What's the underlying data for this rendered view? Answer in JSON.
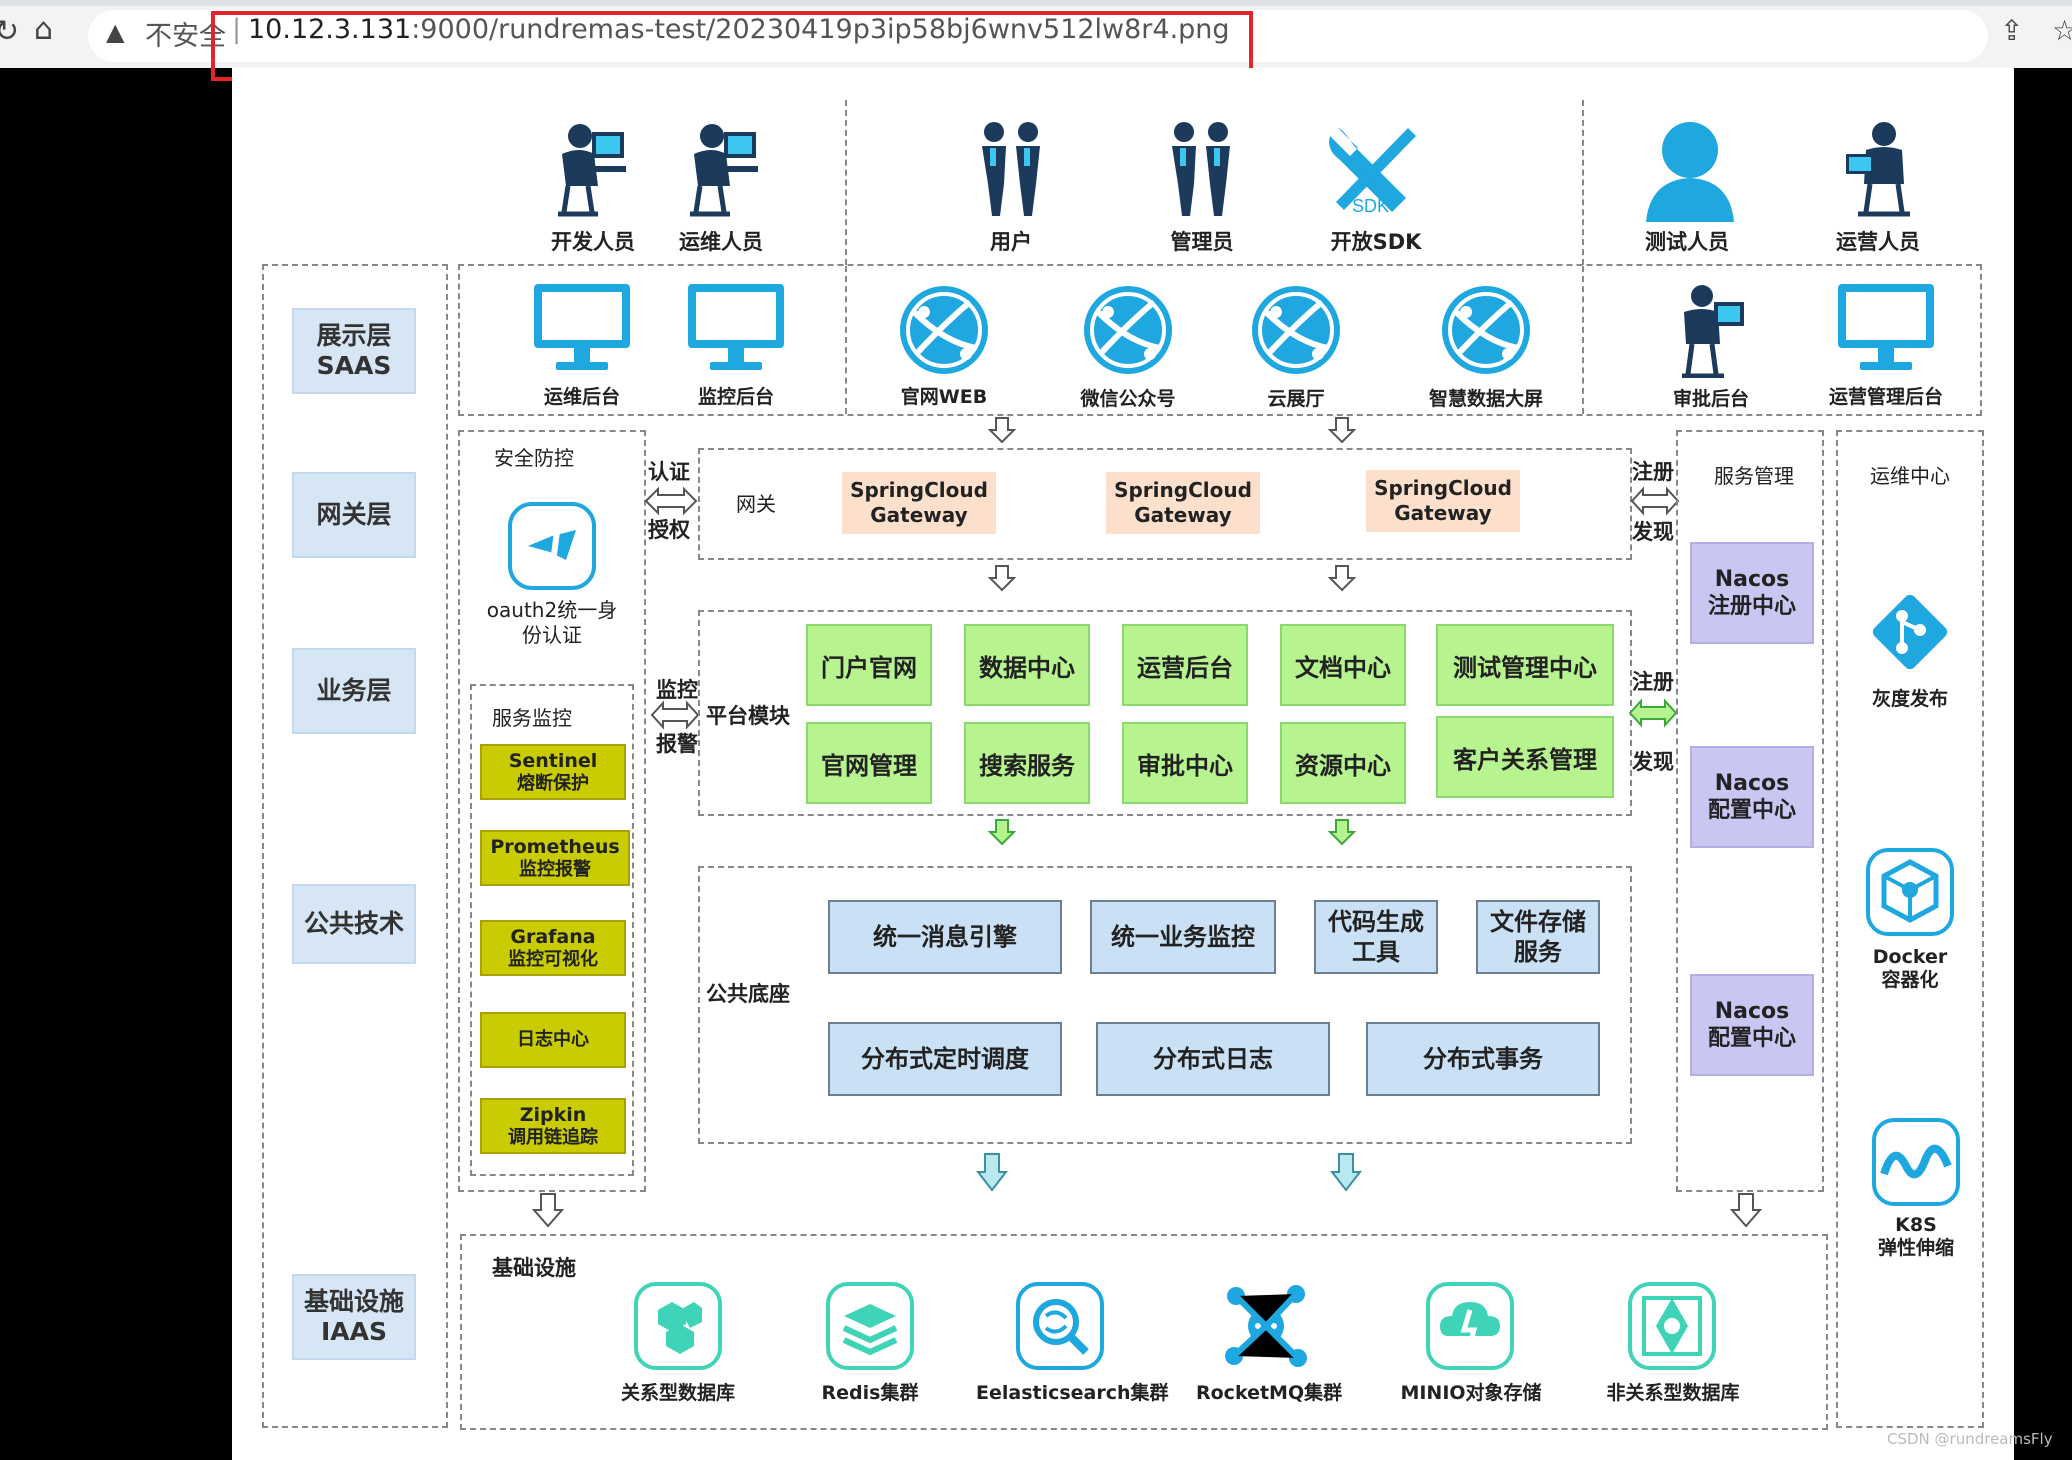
{
  "browser": {
    "insecure_label": "不安全",
    "url_host": "10.12.3.131",
    "url_path": ":9000/rundremas-test/20230419p3ip58bj6wnv512lw8r4.png"
  },
  "roles": [
    "开发人员",
    "运维人员",
    "用户",
    "管理员",
    "开放SDK",
    "测试人员",
    "运营人员"
  ],
  "layers": [
    "展示层\nSAAS",
    "网关层",
    "业务层",
    "公共技术",
    "基础设施\nIAAS"
  ],
  "saas": {
    "items": [
      "运维后台",
      "监控后台",
      "官网WEB",
      "微信公众号",
      "云展厅",
      "智慧数据大屏",
      "审批后台",
      "运营管理后台"
    ]
  },
  "security": {
    "title": "安全防控",
    "oauth": "oauth2统一身\n份认证",
    "auth_left": "认证",
    "auth_right": "授权"
  },
  "gateway": {
    "title": "网关",
    "items": [
      "SpringCloud\nGateway",
      "SpringCloud\nGateway",
      "SpringCloud\nGateway"
    ],
    "reg": "注册",
    "disc": "发现"
  },
  "monitor": {
    "title": "服务监控",
    "items": [
      {
        "t": "Sentinel",
        "s": "熔断保护"
      },
      {
        "t": "Prometheus",
        "s": "监控报警"
      },
      {
        "t": "Grafana",
        "s": "监控可视化"
      },
      {
        "t": "",
        "s": "日志中心"
      },
      {
        "t": "Zipkin",
        "s": "调用链追踪"
      }
    ],
    "link_top": "监控",
    "link_bottom": "报警"
  },
  "platform": {
    "title": "平台模块",
    "row1": [
      "门户官网",
      "数据中心",
      "运营后台",
      "文档中心",
      "测试管理中心"
    ],
    "row2": [
      "官网管理",
      "搜索服务",
      "审批中心",
      "资源中心",
      "客户关系管理"
    ],
    "reg": "注册",
    "disc": "发现"
  },
  "common": {
    "title": "公共底座",
    "row1": [
      "统一消息引擎",
      "统一业务监控",
      "代码生成\n工具",
      "文件存储\n服务"
    ],
    "row2": [
      "分布式定时调度",
      "分布式日志",
      "分布式事务"
    ]
  },
  "service_mgmt": {
    "title": "服务管理",
    "items": [
      "Nacos\n注册中心",
      "Nacos\n配置中心",
      "Nacos\n配置中心"
    ]
  },
  "ops": {
    "title": "运维中心",
    "items": [
      "灰度发布",
      "Docker\n容器化",
      "K8S\n弹性伸缩"
    ]
  },
  "infra": {
    "title": "基础设施",
    "items": [
      "关系型数据库",
      "Redis集群",
      "Eelasticsearch集群",
      "RocketMQ集群",
      "MINIO对象存储",
      "非关系型数据库"
    ]
  },
  "watermark": "CSDN @rundreamsFly",
  "colors": {
    "layer_bg": "#d6e6f5",
    "gateway_bg": "#fce0cc",
    "module_bg": "#b7f48f",
    "common_bg": "#c9e0f5",
    "monitor_bg": "#c8cc00",
    "nacos_bg": "#c9c6f2",
    "icon_blue": "#1fa7e0",
    "icon_dark": "#1b3a5c",
    "icon_teal": "#3fd3b8",
    "url_highlight": "#e3242b"
  }
}
